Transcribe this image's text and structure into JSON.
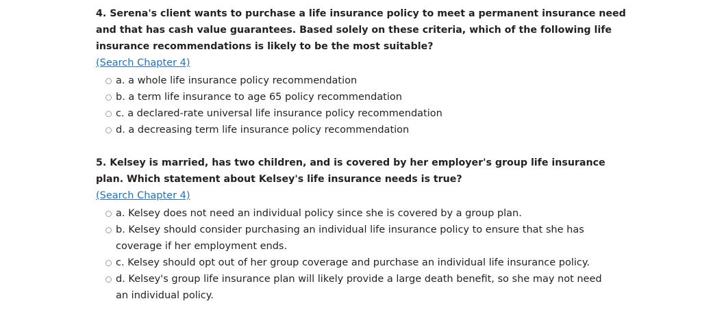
{
  "questions": [
    {
      "text": "4. Serena's client wants to purchase a life insurance policy to meet a permanent insurance need and that has cash value guarantees. Based solely on these criteria, which of the following life insurance recommendations is likely to be the most suitable?",
      "link": "(Search Chapter 4)",
      "options": [
        "a. a whole life insurance policy recommendation",
        "b. a term life insurance to age 65 policy recommendation",
        "c. a declared-rate universal life insurance policy recommendation",
        "d. a decreasing term life insurance policy recommendation"
      ]
    },
    {
      "text": "5. Kelsey is married, has two children, and is covered by her employer's group life insurance plan. Which statement about Kelsey's life insurance needs is true?",
      "link": "(Search Chapter 4)",
      "options": [
        "a. Kelsey does not need an individual policy since she is covered by a group plan.",
        "b. Kelsey should consider purchasing an individual life insurance policy to ensure that she has coverage if her employment ends.",
        "c. Kelsey should opt out of her group coverage and purchase an individual life insurance policy.",
        "d. Kelsey's group life insurance plan will likely provide a large death benefit, so she may not need an individual policy."
      ]
    }
  ]
}
